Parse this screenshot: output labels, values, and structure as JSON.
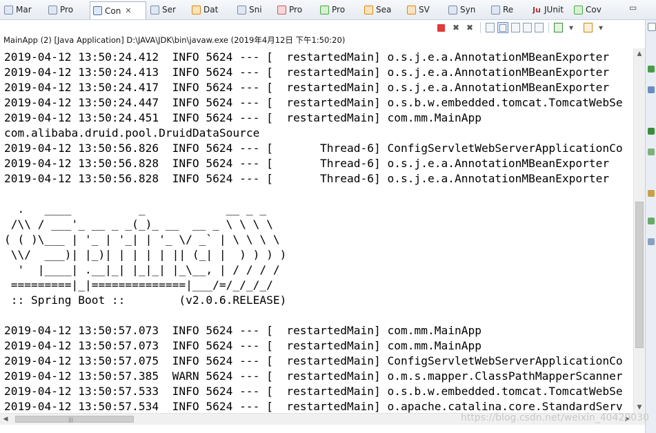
{
  "tabs": [
    {
      "label": "Mar",
      "icon": "markers-icon"
    },
    {
      "label": "Pro",
      "icon": "properties-icon"
    },
    {
      "label": "Con",
      "icon": "console-icon",
      "active": true
    },
    {
      "label": "Ser",
      "icon": "servers-icon"
    },
    {
      "label": "Dat",
      "icon": "data-source-icon"
    },
    {
      "label": "Sni",
      "icon": "snippets-icon"
    },
    {
      "label": "Pro",
      "icon": "problems-icon"
    },
    {
      "label": "Pro",
      "icon": "progress-icon"
    },
    {
      "label": "Sea",
      "icon": "search-icon"
    },
    {
      "label": "SV",
      "icon": "svn-icon"
    },
    {
      "label": "Syn",
      "icon": "synchronize-icon"
    },
    {
      "label": "Re",
      "icon": "repositories-icon"
    },
    {
      "label": "JUnit",
      "icon": "junit-icon"
    },
    {
      "label": "Cov",
      "icon": "coverage-icon"
    }
  ],
  "tab_close_glyph": "✕",
  "window_buttons": {
    "minimize": "▭",
    "maximize": "□"
  },
  "process_label": "MainApp (2) [Java Application] D:\\JAVA\\JDK\\bin\\javaw.exe (2019年4月12日 下午1:50:20)",
  "console_lines": [
    "2019-04-12 13:50:24.412  INFO 5624 --- [  restartedMain] o.s.j.e.a.AnnotationMBeanExporter",
    "2019-04-12 13:50:24.413  INFO 5624 --- [  restartedMain] o.s.j.e.a.AnnotationMBeanExporter",
    "2019-04-12 13:50:24.417  INFO 5624 --- [  restartedMain] o.s.j.e.a.AnnotationMBeanExporter",
    "2019-04-12 13:50:24.447  INFO 5624 --- [  restartedMain] o.s.b.w.embedded.tomcat.TomcatWebSe",
    "2019-04-12 13:50:24.451  INFO 5624 --- [  restartedMain] com.mm.MainApp",
    "com.alibaba.druid.pool.DruidDataSource",
    "2019-04-12 13:50:56.826  INFO 5624 --- [       Thread-6] ConfigServletWebServerApplicationCo",
    "2019-04-12 13:50:56.828  INFO 5624 --- [       Thread-6] o.s.j.e.a.AnnotationMBeanExporter",
    "2019-04-12 13:50:56.828  INFO 5624 --- [       Thread-6] o.s.j.e.a.AnnotationMBeanExporter",
    "",
    "",
    "  .   ____          _            __ _ _",
    " /\\\\ / ___'_ __ _ _(_)_ __  __ _ \\ \\ \\ \\",
    "( ( )\\___ | '_ | '_| | '_ \\/ _` | \\ \\ \\ \\",
    " \\\\/  ___)| |_)| | | | | || (_| |  ) ) ) )",
    "  '  |____| .__|_| |_|_| |_\\__, | / / / /",
    " =========|_|==============|___/=/_/_/_/",
    " :: Spring Boot ::        (v2.0.6.RELEASE)",
    "",
    "2019-04-12 13:50:57.073  INFO 5624 --- [  restartedMain] com.mm.MainApp",
    "2019-04-12 13:50:57.073  INFO 5624 --- [  restartedMain] com.mm.MainApp",
    "2019-04-12 13:50:57.075  INFO 5624 --- [  restartedMain] ConfigServletWebServerApplicationCo",
    "2019-04-12 13:50:57.385  WARN 5624 --- [  restartedMain] o.m.s.mapper.ClassPathMapperScanner",
    "2019-04-12 13:50:57.533  INFO 5624 --- [  restartedMain] o.s.b.w.embedded.tomcat.TomcatWebSe",
    "2019-04-12 13:50:57.534  INFO 5624 --- [  restartedMain] o.apache.catalina.core.StandardServ"
  ],
  "scrollbar_glyphs": {
    "up": "▲",
    "down": "▼",
    "left": "◀",
    "right": "▶",
    "grip": "|||"
  },
  "watermark": "https://blog.csdn.net/weixin_40420030"
}
